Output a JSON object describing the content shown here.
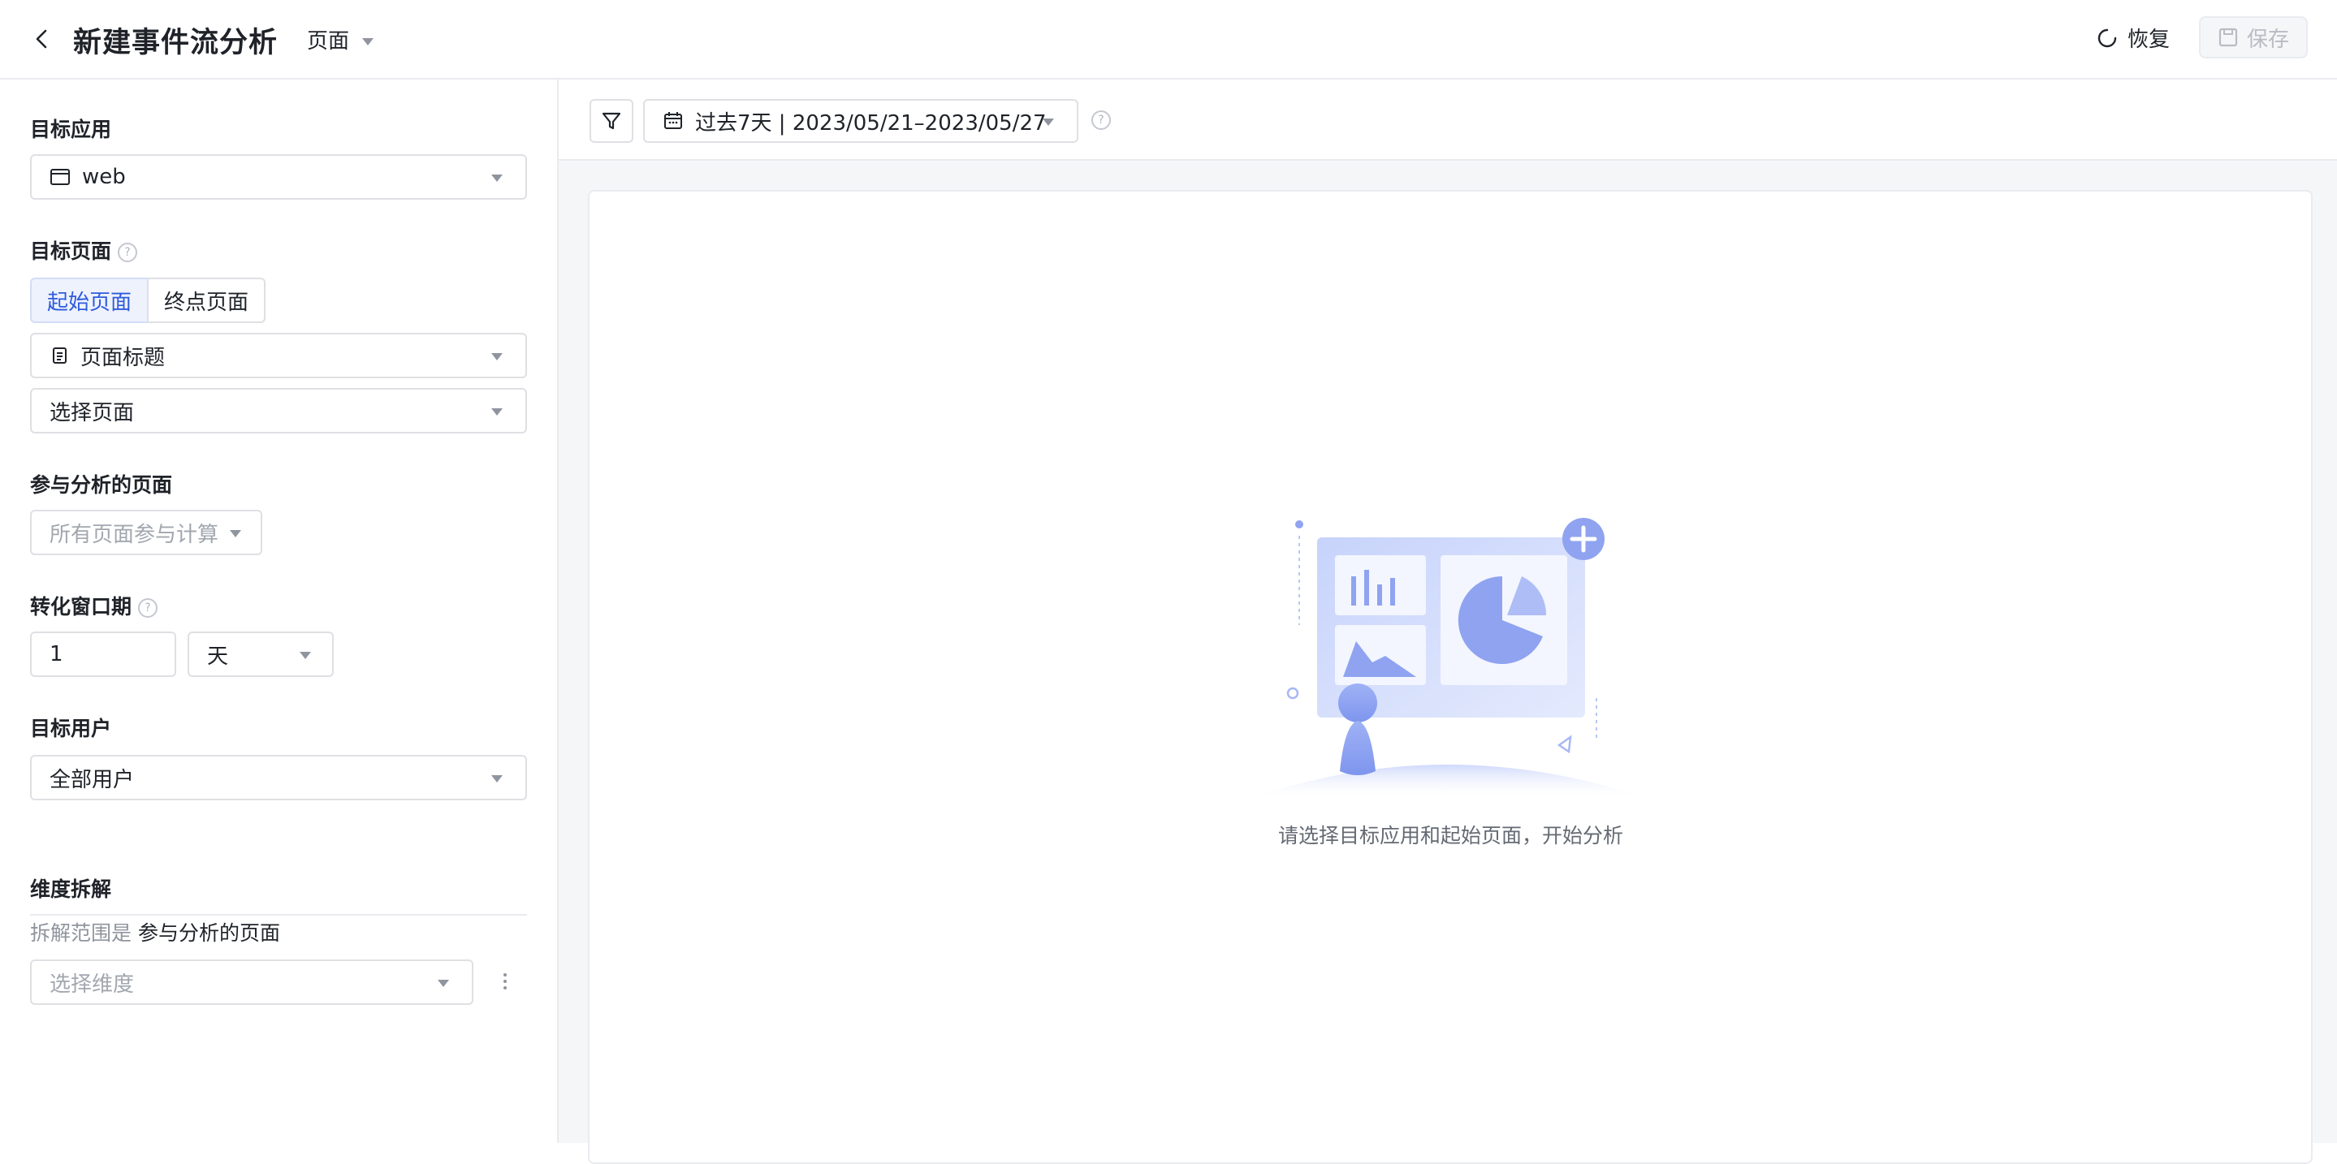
{
  "header": {
    "title": "新建事件流分析",
    "type_select": "页面",
    "restore_label": "恢复",
    "save_label": "保存"
  },
  "sidebar": {
    "target_app": {
      "label": "目标应用",
      "value": "web"
    },
    "target_page": {
      "label": "目标页面",
      "tabs": [
        "起始页面",
        "终点页面"
      ],
      "active_tab": "起始页面",
      "attribute_select": "页面标题",
      "page_select_placeholder": "选择页面"
    },
    "analysis_pages": {
      "label": "参与分析的页面",
      "placeholder": "所有页面参与计算"
    },
    "conversion_window": {
      "label": "转化窗口期",
      "value": "1",
      "unit": "天"
    },
    "target_users": {
      "label": "目标用户",
      "value": "全部用户"
    },
    "dimension": {
      "label": "维度拆解",
      "scope_prefix": "拆解范围是",
      "scope_value": "参与分析的页面",
      "placeholder": "选择维度"
    }
  },
  "toolbar": {
    "date_range": "过去7天 | 2023/05/21–2023/05/27"
  },
  "empty_state": {
    "message": "请选择目标应用和起始页面，开始分析"
  },
  "colors": {
    "accent": "#2e5bdc",
    "illustration": "#8fa3f0",
    "background": "#f5f6f8"
  }
}
